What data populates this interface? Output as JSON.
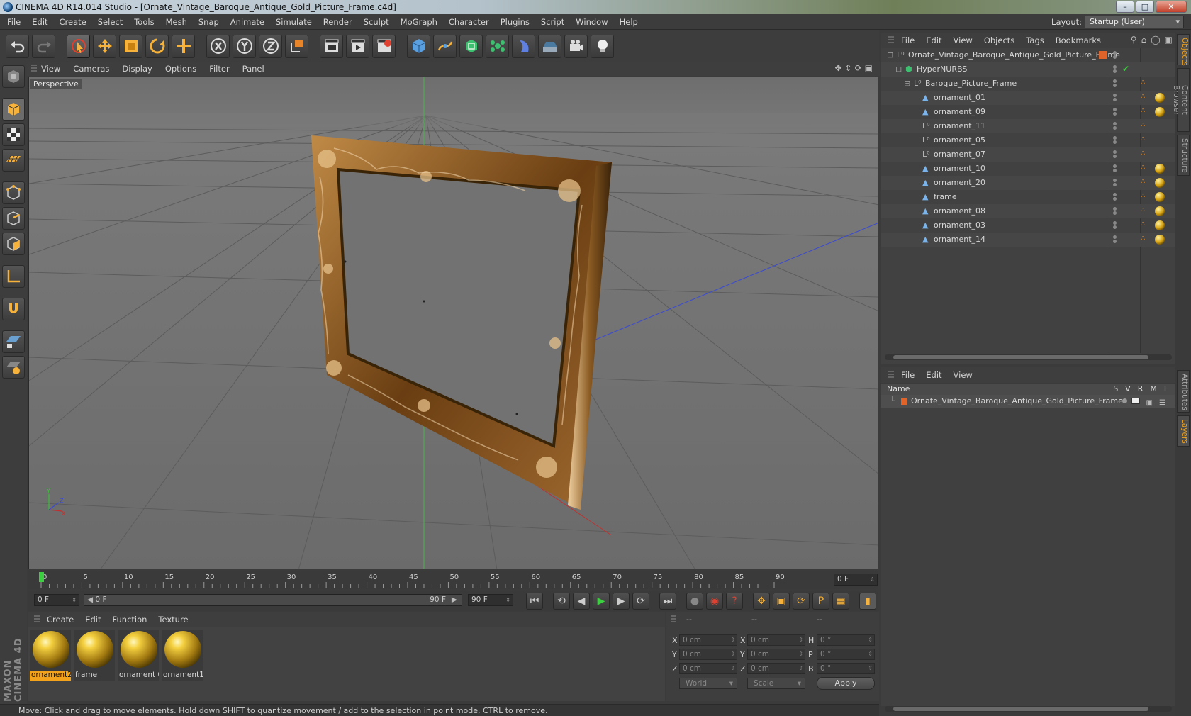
{
  "window": {
    "title": "CINEMA 4D R14.014 Studio - [Ornate_Vintage_Baroque_Antique_Gold_Picture_Frame.c4d]",
    "minimize": "–",
    "maximize": "□",
    "close": "✕"
  },
  "menu": [
    "File",
    "Edit",
    "Create",
    "Select",
    "Tools",
    "Mesh",
    "Snap",
    "Animate",
    "Simulate",
    "Render",
    "Sculpt",
    "MoGraph",
    "Character",
    "Plugins",
    "Script",
    "Window",
    "Help"
  ],
  "layout": {
    "label": "Layout:",
    "value": "Startup (User)"
  },
  "toolbar": {
    "icons": [
      "undo-icon",
      "redo-icon",
      "live-selection-icon",
      "move-icon",
      "scale-icon",
      "rotate-icon",
      "create-tool-icon",
      "x-axis-icon",
      "y-axis-icon",
      "z-axis-icon",
      "world-coordinates-icon",
      "render-view-icon",
      "render-picture-viewer-icon",
      "edit-render-settings-icon",
      "cube-icon",
      "spline-pen-icon",
      "nurbs-icon",
      "array-icon",
      "deformer-icon",
      "floor-icon",
      "camera-icon",
      "light-icon"
    ]
  },
  "viewport": {
    "menu": [
      "View",
      "Cameras",
      "Display",
      "Options",
      "Filter",
      "Panel"
    ],
    "label": "Perspective",
    "axis": {
      "y": "Y",
      "x": "X",
      "z": "Z"
    }
  },
  "timeline": {
    "ticks": [
      0,
      5,
      10,
      15,
      20,
      25,
      30,
      35,
      40,
      45,
      50,
      55,
      60,
      65,
      70,
      75,
      80,
      85,
      90
    ],
    "current_frame": "0 F",
    "start_field": "0 F",
    "range_start": "0 F",
    "range_end": "90 F",
    "end_field": "90 F"
  },
  "material_manager": {
    "menu": [
      "Create",
      "Edit",
      "Function",
      "Texture"
    ],
    "materials": [
      {
        "label": "ornament2",
        "selected": true
      },
      {
        "label": "frame",
        "selected": false
      },
      {
        "label": "ornament 0",
        "selected": false
      },
      {
        "label": "ornament1",
        "selected": false
      }
    ]
  },
  "coordinates": {
    "headers": [
      "--",
      "--",
      "--"
    ],
    "rows": [
      {
        "axis1": "X",
        "v1": "0 cm",
        "axis2": "X",
        "v2": "0 cm",
        "axis3": "H",
        "v3": "0 °"
      },
      {
        "axis1": "Y",
        "v1": "0 cm",
        "axis2": "Y",
        "v2": "0 cm",
        "axis3": "P",
        "v3": "0 °"
      },
      {
        "axis1": "Z",
        "v1": "0 cm",
        "axis2": "Z",
        "v2": "0 cm",
        "axis3": "B",
        "v3": "0 °"
      }
    ],
    "mode": "World",
    "size_mode": "Scale",
    "apply": "Apply"
  },
  "status": "Move: Click and drag to move elements. Hold down SHIFT to quantize movement / add to the selection in point mode, CTRL to remove.",
  "maxon": "MAXON CINEMA 4D",
  "object_manager": {
    "menu": [
      "File",
      "Edit",
      "View",
      "Objects",
      "Tags",
      "Bookmarks"
    ],
    "objects": [
      {
        "name": "Ornate_Vintage_Baroque_Antique_Gold_Picture_Frame",
        "level": 0,
        "icon": "null-icon"
      },
      {
        "name": "HyperNURBS",
        "level": 1,
        "icon": "hypernurbs-icon"
      },
      {
        "name": "Baroque_Picture_Frame",
        "level": 2,
        "icon": "null-icon"
      },
      {
        "name": "ornament_01",
        "level": 3,
        "icon": "polygon-icon"
      },
      {
        "name": "ornament_09",
        "level": 3,
        "icon": "polygon-icon"
      },
      {
        "name": "ornament_11",
        "level": 3,
        "icon": "null-icon"
      },
      {
        "name": "ornament_05",
        "level": 3,
        "icon": "null-icon"
      },
      {
        "name": "ornament_07",
        "level": 3,
        "icon": "null-icon"
      },
      {
        "name": "ornament_10",
        "level": 3,
        "icon": "polygon-icon"
      },
      {
        "name": "ornament_20",
        "level": 3,
        "icon": "polygon-icon"
      },
      {
        "name": "frame",
        "level": 3,
        "icon": "polygon-icon"
      },
      {
        "name": "ornament_08",
        "level": 3,
        "icon": "polygon-icon"
      },
      {
        "name": "ornament_03",
        "level": 3,
        "icon": "polygon-icon"
      },
      {
        "name": "ornament_14",
        "level": 3,
        "icon": "polygon-icon"
      }
    ]
  },
  "layer_manager": {
    "menu": [
      "File",
      "Edit",
      "View"
    ],
    "header": {
      "name": "Name",
      "cols": [
        "S",
        "V",
        "R",
        "M",
        "L"
      ]
    },
    "row": "Ornate_Vintage_Baroque_Antique_Gold_Picture_Frame"
  },
  "right_tabs": [
    "Objects",
    "Content Browser",
    "Structure",
    "Attributes",
    "Layers"
  ],
  "colors": {
    "accent": "#f2a31b",
    "frame": "#8a5a22",
    "grid": "#5a5a5a"
  }
}
